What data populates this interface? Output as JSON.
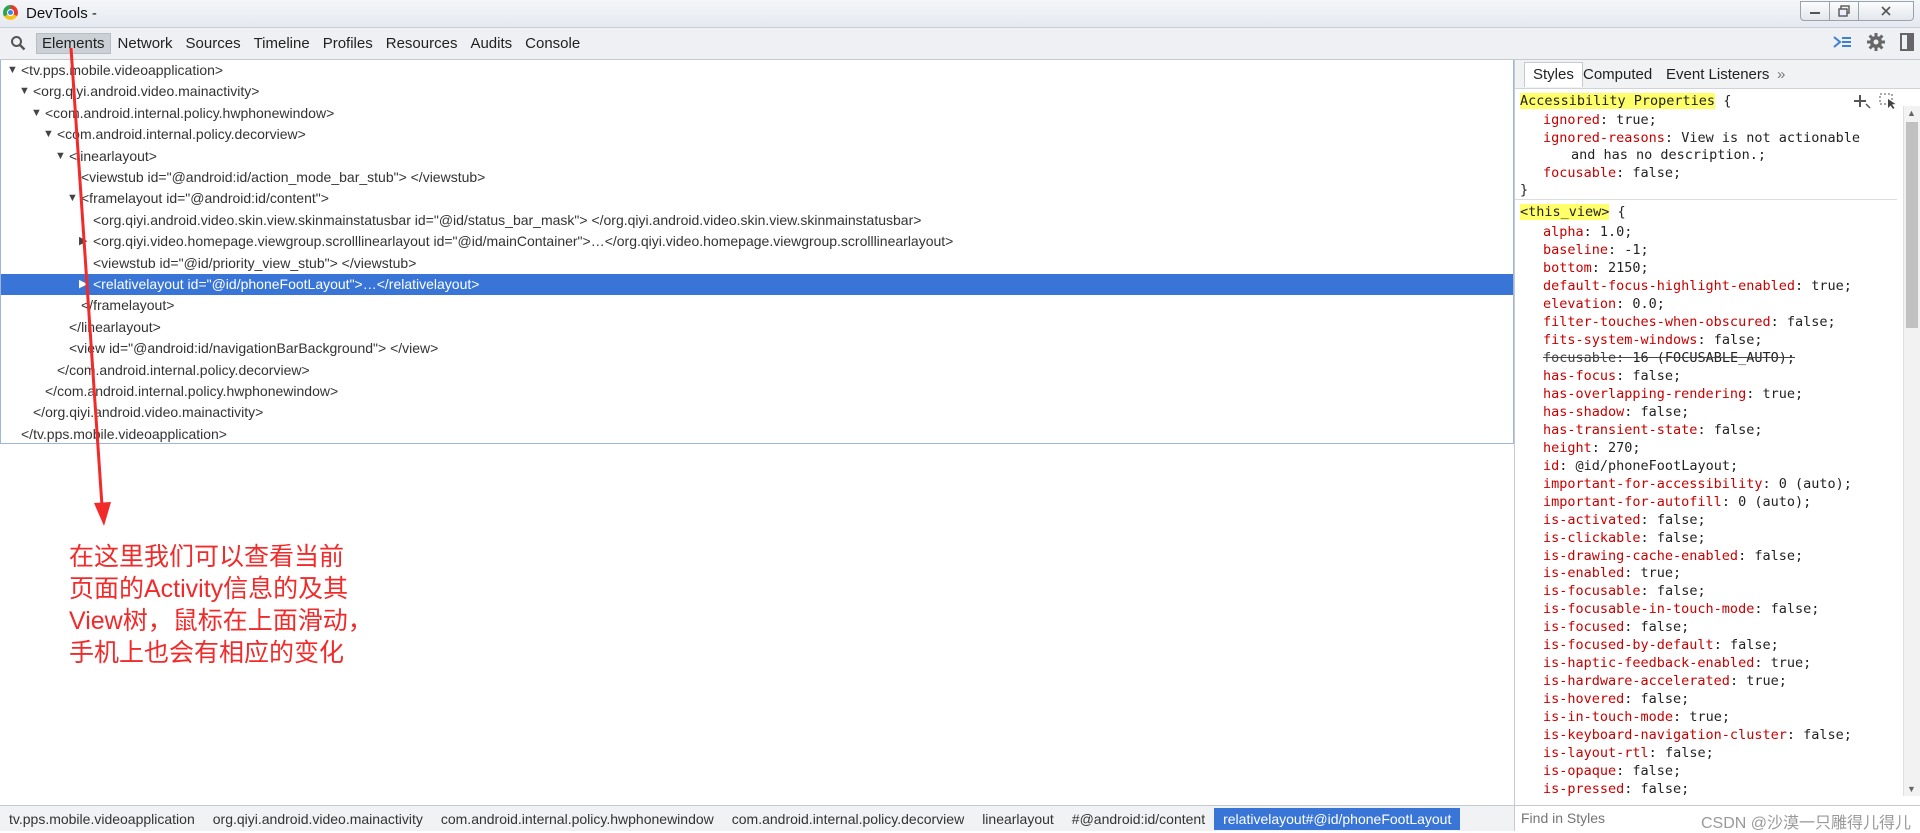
{
  "window": {
    "title": "DevTools -",
    "minimize": "▭",
    "restore": "⧉",
    "close": "✕"
  },
  "toolbar": {
    "tabs": [
      "Elements",
      "Network",
      "Sources",
      "Timeline",
      "Profiles",
      "Resources",
      "Audits",
      "Console"
    ],
    "active_tab": "Elements"
  },
  "dom_tree": [
    {
      "text": "<tv.pps.mobile.videoapplication>",
      "toggle": "▼"
    },
    {
      "text": "<org.qiyi.android.video.mainactivity>",
      "toggle": "▼"
    },
    {
      "text": "<com.android.internal.policy.hwphonewindow>",
      "toggle": "▼"
    },
    {
      "text": "<com.android.internal.policy.decorview>",
      "toggle": "▼"
    },
    {
      "text": "<linearlayout>",
      "toggle": "▼"
    },
    {
      "text": "<viewstub id=\"@android:id/action_mode_bar_stub\"> </viewstub>",
      "toggle": ""
    },
    {
      "text": "<framelayout id=\"@android:id/content\">",
      "toggle": "▼"
    },
    {
      "text": "<org.qiyi.android.video.skin.view.skinmainstatusbar id=\"@id/status_bar_mask\"> </org.qiyi.android.video.skin.view.skinmainstatusbar>",
      "toggle": ""
    },
    {
      "text": "<org.qiyi.video.homepage.viewgroup.scrolllinearlayout id=\"@id/mainContainer\">…</org.qiyi.video.homepage.viewgroup.scrolllinearlayout>",
      "toggle": "▶"
    },
    {
      "text": "<viewstub id=\"@id/priority_view_stub\"> </viewstub>",
      "toggle": ""
    },
    {
      "text": "<relativelayout id=\"@id/phoneFootLayout\">…</relativelayout>",
      "toggle": "▶"
    },
    {
      "text": "</framelayout>",
      "toggle": ""
    },
    {
      "text": "</linearlayout>",
      "toggle": ""
    },
    {
      "text": "<view id=\"@android:id/navigationBarBackground\"> </view>",
      "toggle": ""
    },
    {
      "text": "</com.android.internal.policy.decorview>",
      "toggle": ""
    },
    {
      "text": "</com.android.internal.policy.hwphonewindow>",
      "toggle": ""
    },
    {
      "text": "</org.qiyi.android.video.mainactivity>",
      "toggle": ""
    },
    {
      "text": "</tv.pps.mobile.videoapplication>",
      "toggle": ""
    }
  ],
  "annotation": {
    "lines": [
      "在这里我们可以查看当前",
      "页面的Activity信息的及其",
      "View树，鼠标在上面滑动，",
      "手机上也会有相应的变化"
    ],
    "color": "#f12a2a"
  },
  "styles_pane": {
    "tabs": [
      "Styles",
      "Computed",
      "Event Listeners"
    ],
    "more": "»",
    "accessibility": {
      "selector": "Accessibility Properties",
      "open": " {",
      "close": "}",
      "props": [
        {
          "name": "ignored",
          "value": "true;"
        },
        {
          "name": "ignored-reasons",
          "value": "View is not actionable"
        },
        {
          "name": "",
          "value": "and has no description.;"
        },
        {
          "name": "focusable",
          "value": "false;"
        }
      ]
    },
    "this_view": {
      "selector": "<this_view>",
      "open": " {",
      "props": [
        {
          "name": "alpha",
          "value": "1.0;"
        },
        {
          "name": "baseline",
          "value": "-1;"
        },
        {
          "name": "bottom",
          "value": "2150;"
        },
        {
          "name": "default-focus-highlight-enabled",
          "value": "true;"
        },
        {
          "name": "elevation",
          "value": "0.0;"
        },
        {
          "name": "filter-touches-when-obscured",
          "value": "false;"
        },
        {
          "name": "fits-system-windows",
          "value": "false;"
        },
        {
          "name": "focusable",
          "value": "16 (FOCUSABLE_AUTO);",
          "strike": true
        },
        {
          "name": "has-focus",
          "value": "false;"
        },
        {
          "name": "has-overlapping-rendering",
          "value": "true;"
        },
        {
          "name": "has-shadow",
          "value": "false;"
        },
        {
          "name": "has-transient-state",
          "value": "false;"
        },
        {
          "name": "height",
          "value": "270;"
        },
        {
          "name": "id",
          "value": "@id/phoneFootLayout;"
        },
        {
          "name": "important-for-accessibility",
          "value": "0 (auto);"
        },
        {
          "name": "important-for-autofill",
          "value": "0 (auto);"
        },
        {
          "name": "is-activated",
          "value": "false;"
        },
        {
          "name": "is-clickable",
          "value": "false;"
        },
        {
          "name": "is-drawing-cache-enabled",
          "value": "false;"
        },
        {
          "name": "is-enabled",
          "value": "true;"
        },
        {
          "name": "is-focusable",
          "value": "false;"
        },
        {
          "name": "is-focusable-in-touch-mode",
          "value": "false;"
        },
        {
          "name": "is-focused",
          "value": "false;"
        },
        {
          "name": "is-focused-by-default",
          "value": "false;"
        },
        {
          "name": "is-haptic-feedback-enabled",
          "value": "true;"
        },
        {
          "name": "is-hardware-accelerated",
          "value": "true;"
        },
        {
          "name": "is-hovered",
          "value": "false;"
        },
        {
          "name": "is-in-touch-mode",
          "value": "true;"
        },
        {
          "name": "is-keyboard-navigation-cluster",
          "value": "false;"
        },
        {
          "name": "is-layout-rtl",
          "value": "false;"
        },
        {
          "name": "is-opaque",
          "value": "false;"
        },
        {
          "name": "is-pressed",
          "value": "false;"
        }
      ]
    }
  },
  "breadcrumb": [
    "tv.pps.mobile.videoapplication",
    "org.qiyi.android.video.mainactivity",
    "com.android.internal.policy.hwphonewindow",
    "com.android.internal.policy.decorview",
    "linearlayout",
    "#@android:id/content",
    "relativelayout#@id/phoneFootLayout"
  ],
  "find_styles": {
    "placeholder": "Find in Styles"
  },
  "watermark": "CSDN @沙漠一只雕得儿得儿",
  "colors": {
    "selection": "#3875d7",
    "property_name": "#c80000",
    "selector_highlight": "#ffff6a"
  }
}
